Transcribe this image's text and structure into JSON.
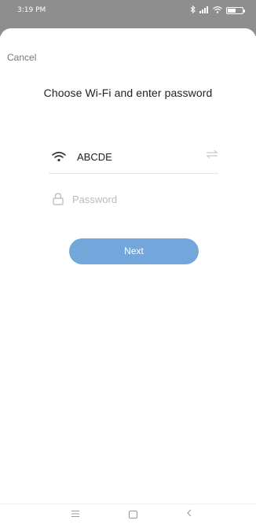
{
  "status_bar": {
    "time": "3:19 PM"
  },
  "header": {
    "cancel_label": "Cancel",
    "title": "Choose Wi-Fi and enter password"
  },
  "form": {
    "ssid": "ABCDE",
    "password_value": "",
    "password_placeholder": "Password",
    "next_label": "Next"
  },
  "icons": {
    "status": [
      "bluetooth-icon",
      "signal-icon",
      "wifi-icon",
      "battery-icon"
    ],
    "wifi_row": [
      "wifi-icon",
      "switch-network-icon"
    ],
    "password_row": [
      "lock-icon"
    ],
    "nav": [
      "menu-icon",
      "home-icon",
      "back-icon"
    ]
  },
  "colors": {
    "accent": "#73a7dc",
    "status_bar": "#8e8e8e"
  }
}
